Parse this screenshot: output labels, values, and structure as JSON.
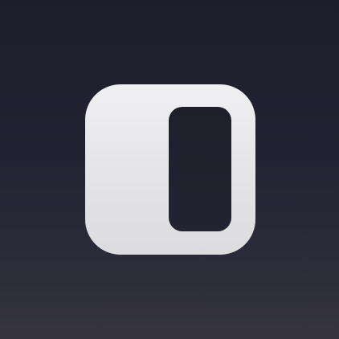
{
  "app_icon": {
    "icon": "panel-split-icon",
    "colors": {
      "background_top": "#1d1d2b",
      "background_bottom": "#35343f",
      "tile": "#e6e6e8",
      "slot": "#212130"
    }
  }
}
